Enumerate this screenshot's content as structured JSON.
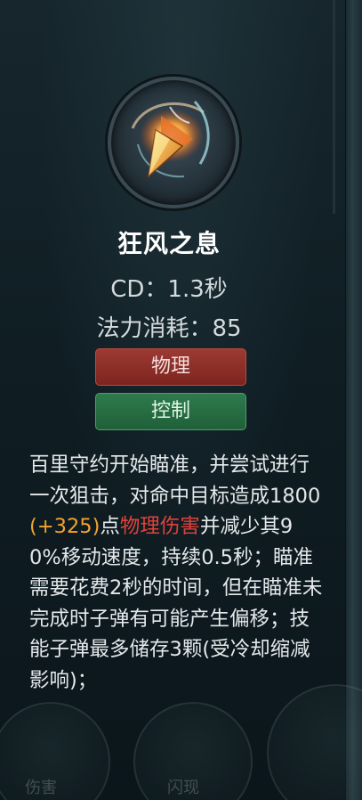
{
  "skill": {
    "name": "狂风之息",
    "cd": "CD：1.3秒",
    "mana_cost": "法力消耗：85",
    "icon": "flaming-arrow-icon"
  },
  "tags": {
    "damage_type": "物理",
    "effect_type": "控制"
  },
  "description": {
    "part1": "百里守约开始瞄准，并尝试进行一次狙击，对命中目标造成1800",
    "bonus": "(+325)",
    "part2": "点",
    "damage_label": "物理伤害",
    "part3": "并减少其90%移动速度，持续0.5秒；瞄准需要花费2秒的时间，但在瞄准未完成时子弹有可能产生偏移；技能子弹最多储存3颗(受冷却缩减影响)；"
  },
  "background_hud": {
    "left_label": "伤害",
    "mid_label": "闪现"
  },
  "colors": {
    "bonus": "#f2a32f",
    "physical_damage": "#e2413a",
    "tag_physical": "#8e2f28",
    "tag_control": "#277048"
  }
}
